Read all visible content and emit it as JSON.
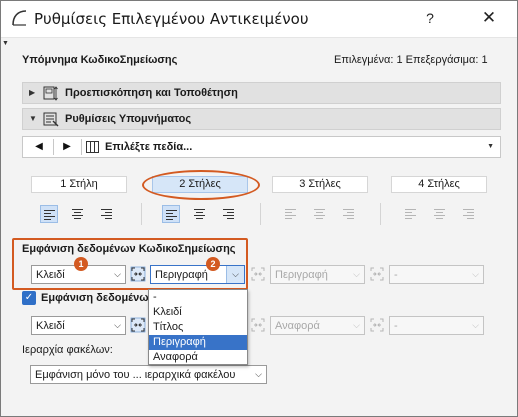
{
  "window": {
    "title": "Ρυθμίσεις Επιλεγμένου Αντικειμένου",
    "help_label": "?",
    "close_label": "✕"
  },
  "header": {
    "label": "Υπόμνημα ΚωδικοΣημείωσης",
    "status": "Επιλεγμένα: 1 Επεξεργάσιμα: 1"
  },
  "sections": {
    "preview": {
      "label": "Προεπισκόπηση και Τοποθέτηση",
      "icon": "preview-positioning-icon"
    },
    "settings": {
      "label": "Ρυθμίσεις Υπομνήματος",
      "icon": "legend-settings-icon"
    }
  },
  "navbar": {
    "prev_label": "◀",
    "next_label": "▶",
    "fields_label": "Επιλέξτε πεδία..."
  },
  "columns": [
    "1 Στήλη",
    "2 Στήλες",
    "3 Στήλες",
    "4 Στήλες"
  ],
  "selected_column": "2 Στήλες",
  "keynote_display": {
    "title": "Εμφάνιση δεδομένων ΚωδικοΣημείωσης",
    "field1": "Κλειδί",
    "field2": "Περιγραφή",
    "field3": "Περιγραφή",
    "field4": "-"
  },
  "source_display": {
    "checked": true,
    "title": "Εμφάνιση δεδομένων",
    "field1": "Κλειδί",
    "field3": "Αναφορά",
    "field4": "-"
  },
  "dropdown_options": [
    "-",
    "Κλειδί",
    "Τίτλος",
    "Περιγραφή",
    "Αναφορά"
  ],
  "dropdown_selected": "Περιγραφή",
  "badges": [
    "1",
    "2"
  ],
  "folder": {
    "label": "Ιεραρχία φακέλων:",
    "value": "Εμφάνιση μόνο του ... ιεραρχικά φακέλου"
  },
  "colors": {
    "accent": "#3873c8",
    "annotation": "#d35a21",
    "selected_tab": "#d6e6f8"
  }
}
